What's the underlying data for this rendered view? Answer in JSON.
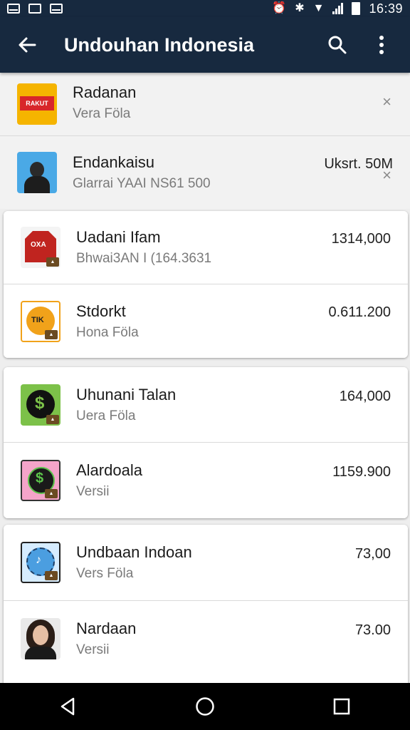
{
  "status_bar": {
    "time": "16:39"
  },
  "app_bar": {
    "title": "Undouhan Indonesia"
  },
  "rows": [
    {
      "name": "Radanan",
      "sub": "Vera Föla",
      "size": "",
      "dismiss": "×",
      "icon": "rakuten-app-icon",
      "icon_color": "#f5b400"
    },
    {
      "name": "Endankaisu",
      "sub": "Glarrai YAAI NS61 500",
      "size": "Uksrt. 50M",
      "dismiss": "×",
      "icon": "portrait-app-icon",
      "icon_color": "#4aa9e6"
    }
  ],
  "cards": [
    [
      {
        "name": "Uadani Ifam",
        "sub": "Bhwai3AN I (164.3631",
        "size": "1314,000",
        "icon": "red-tag-app-icon",
        "icon_color": "#c0241f"
      },
      {
        "name": "Stdorkt",
        "sub": "Hona Föla",
        "size": "0.611.200",
        "icon": "orange-coin-app-icon",
        "icon_color": "#f1a21a"
      }
    ],
    [
      {
        "name": "Uhunani Talan",
        "sub": "Uera Föla",
        "size": "164,000",
        "icon": "green-dollar-app-icon",
        "icon_color": "#7cc149"
      },
      {
        "name": "Alardoala",
        "sub": "Versii",
        "size": "1159.900",
        "icon": "pink-dollar-app-icon",
        "icon_color": "#f4a4c9"
      }
    ],
    [
      {
        "name": "Undbaan Indoan",
        "sub": "Vers Föla",
        "size": "73,00",
        "icon": "blue-globe-app-icon",
        "icon_color": "#4b9ee0"
      },
      {
        "name": "Nardaan",
        "sub": "Versii",
        "size": "73.00",
        "icon": "woman-portrait-app-icon",
        "icon_color": "#e9e9e9"
      }
    ]
  ],
  "nav": [
    "back-icon",
    "home-icon",
    "recents-icon"
  ]
}
